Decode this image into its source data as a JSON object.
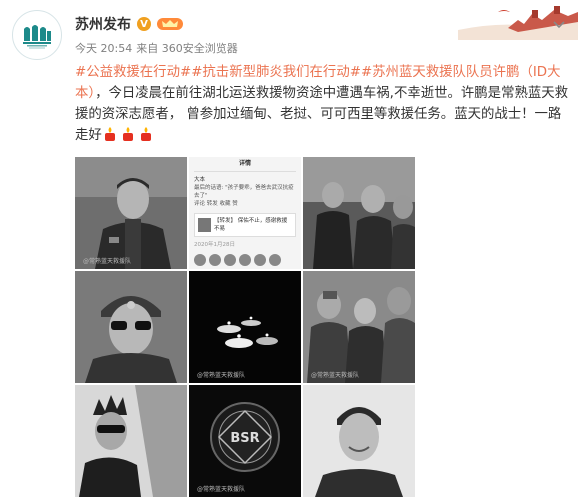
{
  "header": {
    "account_name": "苏州发布",
    "verified_badge": "V",
    "time": "今天 20:54",
    "source": "来自 360安全浏览器",
    "avatar_icon": "suzhou-city-logo"
  },
  "post": {
    "tags": [
      "#公益救援在行动#",
      "#抗击新型肺炎我们在行动#",
      "#苏州蓝天救援队队员许鹏（ID大本）"
    ],
    "text": "，今日凌晨在前往湖北运送救援物资途中遭遇车祸,不幸逝世。许鹏是常熟蓝天救援的资深志愿者， 曾参加过缅甸、老挝、可可西里等救援任务。蓝天的战士！一路走好",
    "emoji": "candle",
    "emoji_count": 3
  },
  "screenshot_cell": {
    "title": "详情",
    "user": "大本",
    "quote": "最后的话语: \"孩子要乖，爸爸去武汉抗疫去了\"",
    "actions": "评论  转发  收藏  赞",
    "card_text": "【转发】 保佑不止，感谢救援不易",
    "date": "2020年1月28日"
  },
  "images": [
    {
      "name": "photo-portrait-uniform",
      "watermark": "@常熟蓝天救援队"
    },
    {
      "name": "photo-screenshot-post",
      "watermark": ""
    },
    {
      "name": "photo-team-group",
      "watermark": ""
    },
    {
      "name": "photo-sunglasses-portrait",
      "watermark": ""
    },
    {
      "name": "photo-candles",
      "watermark": "@常熟蓝天救援队"
    },
    {
      "name": "photo-crowd",
      "watermark": "@常熟蓝天救援队"
    },
    {
      "name": "photo-car-window",
      "watermark": ""
    },
    {
      "name": "photo-bsr-badge",
      "watermark": "@常熟蓝天救援队"
    },
    {
      "name": "photo-smiling-portrait",
      "watermark": ""
    }
  ],
  "colors": {
    "tag": "#eb7350",
    "badge": "#f0a020",
    "text": "#333333",
    "meta": "#808080"
  }
}
